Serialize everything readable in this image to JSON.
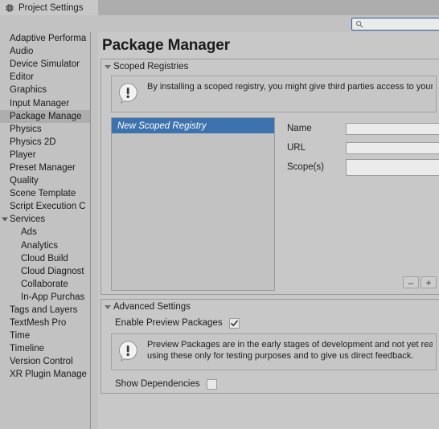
{
  "window": {
    "tab_label": "Project Settings",
    "tab_icon": "gear-icon"
  },
  "search": {
    "value": "",
    "placeholder": "",
    "icon": "search-icon"
  },
  "sidebar": {
    "items": [
      {
        "label": "Adaptive Performa",
        "level": 0,
        "selected": false,
        "foldout": "none"
      },
      {
        "label": "Audio",
        "level": 0,
        "selected": false,
        "foldout": "none"
      },
      {
        "label": "Device Simulator",
        "level": 0,
        "selected": false,
        "foldout": "none"
      },
      {
        "label": "Editor",
        "level": 0,
        "selected": false,
        "foldout": "none"
      },
      {
        "label": "Graphics",
        "level": 0,
        "selected": false,
        "foldout": "none"
      },
      {
        "label": "Input Manager",
        "level": 0,
        "selected": false,
        "foldout": "none"
      },
      {
        "label": "Package Manage",
        "level": 0,
        "selected": true,
        "foldout": "none"
      },
      {
        "label": "Physics",
        "level": 0,
        "selected": false,
        "foldout": "none"
      },
      {
        "label": "Physics 2D",
        "level": 0,
        "selected": false,
        "foldout": "none"
      },
      {
        "label": "Player",
        "level": 0,
        "selected": false,
        "foldout": "none"
      },
      {
        "label": "Preset Manager",
        "level": 0,
        "selected": false,
        "foldout": "none"
      },
      {
        "label": "Quality",
        "level": 0,
        "selected": false,
        "foldout": "none"
      },
      {
        "label": "Scene Template",
        "level": 0,
        "selected": false,
        "foldout": "none"
      },
      {
        "label": "Script Execution C",
        "level": 0,
        "selected": false,
        "foldout": "none"
      },
      {
        "label": "Services",
        "level": 0,
        "selected": false,
        "foldout": "open"
      },
      {
        "label": "Ads",
        "level": 1,
        "selected": false,
        "foldout": "none"
      },
      {
        "label": "Analytics",
        "level": 1,
        "selected": false,
        "foldout": "none"
      },
      {
        "label": "Cloud Build",
        "level": 1,
        "selected": false,
        "foldout": "none"
      },
      {
        "label": "Cloud Diagnost",
        "level": 1,
        "selected": false,
        "foldout": "none"
      },
      {
        "label": "Collaborate",
        "level": 1,
        "selected": false,
        "foldout": "none"
      },
      {
        "label": "In-App Purchas",
        "level": 1,
        "selected": false,
        "foldout": "none"
      },
      {
        "label": "Tags and Layers",
        "level": 0,
        "selected": false,
        "foldout": "none"
      },
      {
        "label": "TextMesh Pro",
        "level": 0,
        "selected": false,
        "foldout": "none"
      },
      {
        "label": "Time",
        "level": 0,
        "selected": false,
        "foldout": "none"
      },
      {
        "label": "Timeline",
        "level": 0,
        "selected": false,
        "foldout": "none"
      },
      {
        "label": "Version Control",
        "level": 0,
        "selected": false,
        "foldout": "none"
      },
      {
        "label": "XR Plugin Manage",
        "level": 0,
        "selected": false,
        "foldout": "none"
      }
    ]
  },
  "main": {
    "title": "Package Manager",
    "scoped_registries": {
      "header": "Scoped Registries",
      "expanded": true,
      "info": {
        "icon": "info-bubble-icon",
        "lines": [
          "By installing a scoped registry, you might give third parties access to your d"
        ]
      },
      "list": {
        "entries": [
          {
            "label": "New Scoped Registry",
            "selected": true
          }
        ],
        "remove_button": "–",
        "add_button": "+"
      },
      "form": {
        "fields": [
          {
            "label": "Name",
            "value": "",
            "tall": false
          },
          {
            "label": "URL",
            "value": "",
            "tall": false
          },
          {
            "label": "Scope(s)",
            "value": "",
            "tall": true
          }
        ]
      }
    },
    "advanced_settings": {
      "header": "Advanced Settings",
      "expanded": true,
      "enable_preview": {
        "label": "Enable Preview Packages",
        "checked": true
      },
      "info": {
        "icon": "info-bubble-icon",
        "lines": [
          "Preview Packages are in the early stages of development and not yet ready",
          "using these only for testing purposes and to give us direct feedback."
        ]
      },
      "show_dependencies": {
        "label": "Show Dependencies",
        "checked": false
      }
    }
  },
  "colors": {
    "window_bg": "#c2c2c2",
    "panel_bg": "#c8c8c8",
    "selection_blue": "#3c72ad",
    "sidebar_selected": "#aeaeae",
    "field_bg": "#ebebeb",
    "focus_border": "#2c5d9b"
  }
}
